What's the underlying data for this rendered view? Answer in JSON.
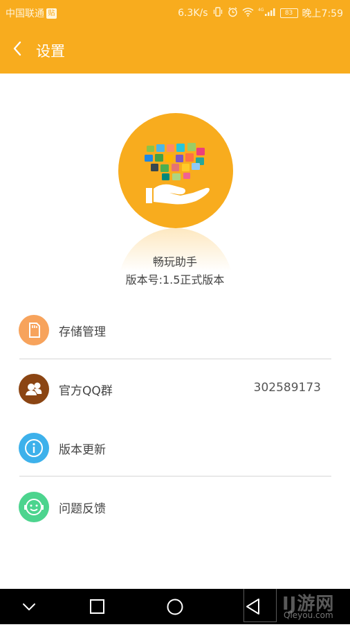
{
  "statusbar": {
    "carrier": "中国联通",
    "carrier_badge": "贴",
    "net_speed": "6.3K/s",
    "signal_label": "4G",
    "battery": "83",
    "time": "晚上7:59"
  },
  "appbar": {
    "title": "设置"
  },
  "about": {
    "app_name": "畅玩助手",
    "version": "版本号:1.5正式版本"
  },
  "settings": {
    "items": [
      {
        "label": "存储管理",
        "value": "",
        "icon": "sd-card-icon",
        "color": "#F7A35C"
      },
      {
        "label": "官方QQ群",
        "value": "302589173",
        "icon": "group-icon",
        "color": "#8B4513"
      },
      {
        "label": "版本更新",
        "value": "",
        "icon": "info-icon",
        "color": "#3DB1EB"
      },
      {
        "label": "问题反馈",
        "value": "",
        "icon": "feedback-icon",
        "color": "#4CD48E"
      }
    ]
  },
  "watermark": {
    "main": "IJ游网",
    "sub": "Qieyou.com"
  },
  "colors": {
    "brand": "#F8AC1E",
    "divider": "#D6D6D6",
    "navbar": "#000000"
  }
}
